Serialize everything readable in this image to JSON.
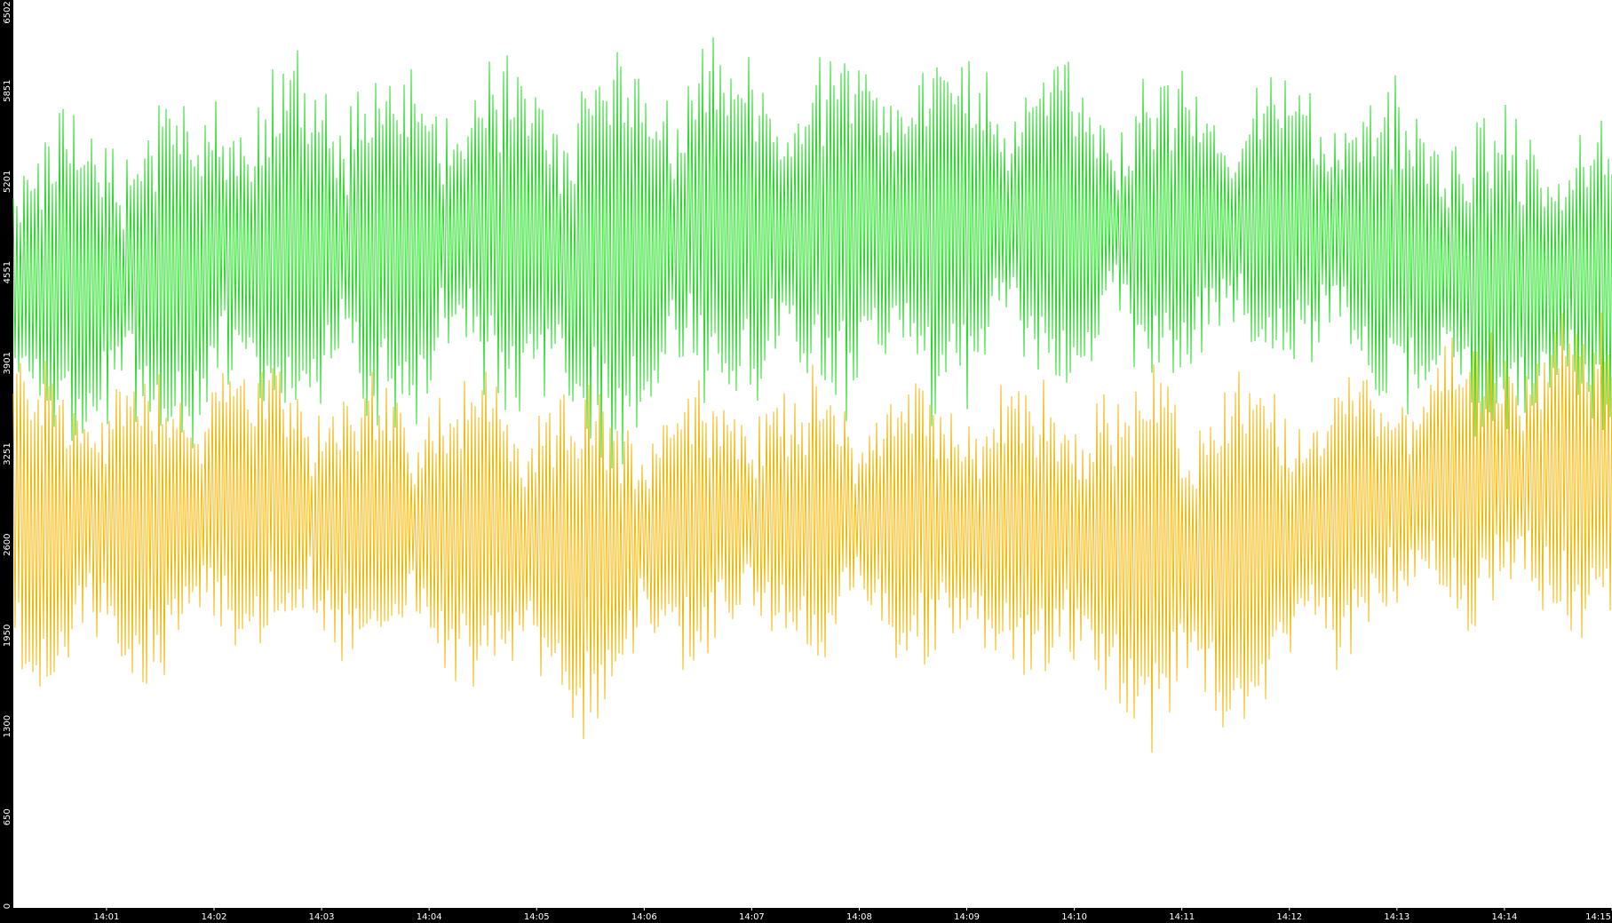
{
  "chart_data": {
    "type": "line",
    "title": "",
    "xlabel": "",
    "ylabel": "",
    "x_tick_labels": [
      "14:01",
      "14:02",
      "14:03",
      "14:04",
      "14:05",
      "14:06",
      "14:07",
      "14:08",
      "14:09",
      "14:10",
      "14:11",
      "14:12",
      "14:13",
      "14:14",
      "14:15"
    ],
    "y_tick_labels": [
      "0",
      "650",
      "1300",
      "1950",
      "2600",
      "3251",
      "3901",
      "4551",
      "5201",
      "5851",
      "6502"
    ],
    "ylim": [
      0,
      6502
    ],
    "x_range_minutes": [
      "14:00:08",
      "14:15:00"
    ],
    "grid": false,
    "legend": "none",
    "background": "#ffffff",
    "frame_color": "#000000",
    "series": [
      {
        "color": "#22dd22",
        "kind": "oscillating",
        "approx_upper_envelope": [
          5500,
          5900,
          6000,
          6150,
          6000,
          6100,
          6200,
          6100,
          6300,
          6100,
          6000,
          6000,
          5900,
          5700,
          5600
        ],
        "approx_lower_envelope": [
          3300,
          3200,
          3400,
          3300,
          3700,
          3100,
          3500,
          3600,
          3500,
          3700,
          3700,
          3800,
          3600,
          3300,
          3500
        ]
      },
      {
        "color": "#f2b705",
        "kind": "oscillating",
        "approx_upper_envelope": [
          4000,
          3900,
          4000,
          3800,
          3900,
          3700,
          3800,
          3800,
          3800,
          3800,
          3900,
          3800,
          3900,
          4200,
          4300
        ],
        "approx_lower_envelope": [
          1600,
          1500,
          1800,
          1700,
          1600,
          1300,
          1800,
          1800,
          1700,
          1600,
          1100,
          1400,
          2000,
          2000,
          1800
        ]
      }
    ]
  }
}
